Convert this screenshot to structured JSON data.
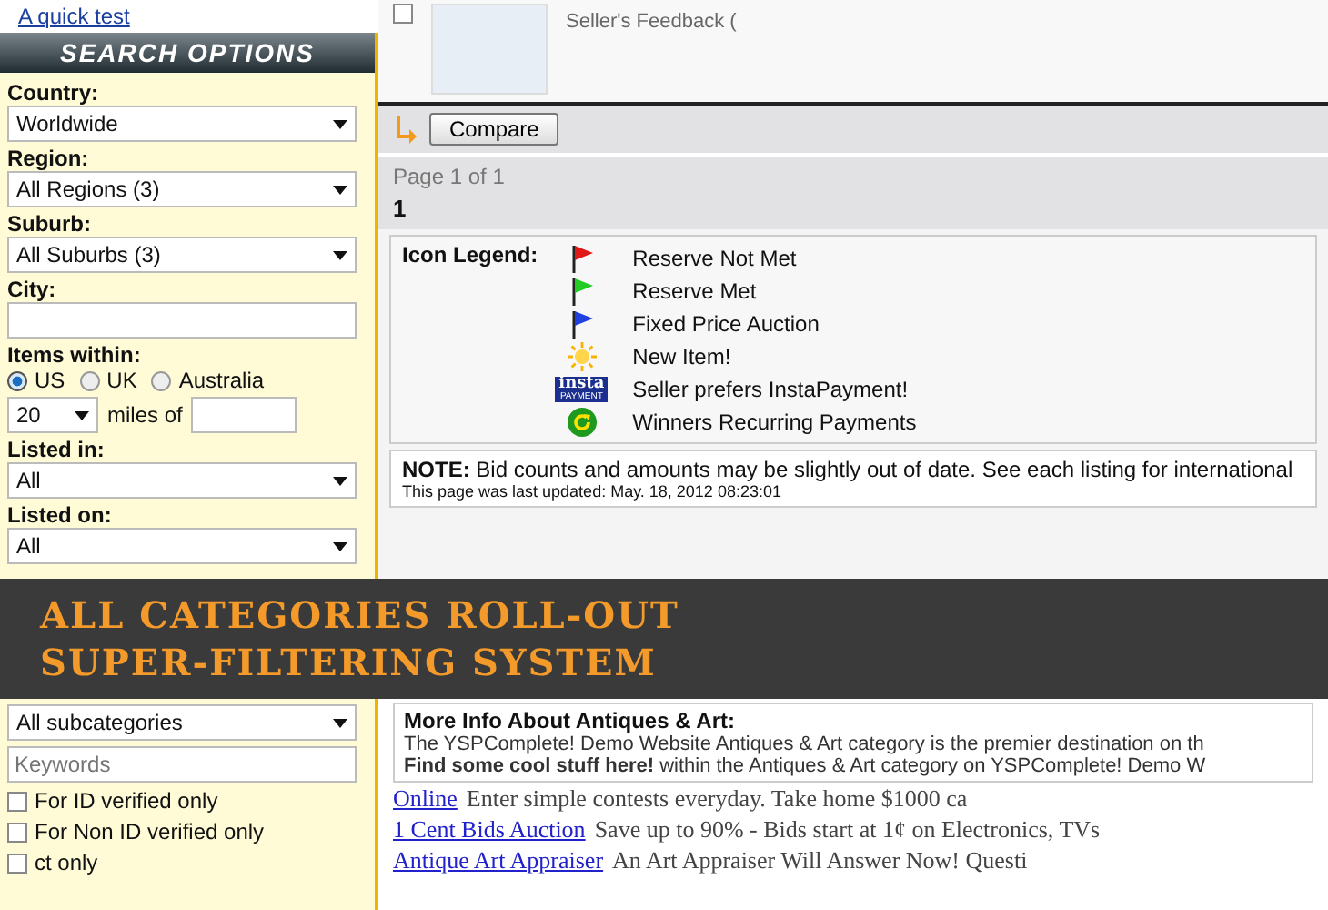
{
  "top_link": "A quick test",
  "sidebar": {
    "title": "SEARCH OPTIONS",
    "fields": [
      {
        "kind": "select",
        "label": "Country:",
        "value": "Worldwide"
      },
      {
        "kind": "select",
        "label": "Region:",
        "value": "All Regions (3)"
      },
      {
        "kind": "select",
        "label": "Suburb:",
        "value": "All Suburbs (3)"
      },
      {
        "kind": "text",
        "label": "City:"
      },
      {
        "kind": "radios",
        "label": "Items within:",
        "options": [
          {
            "label": "US",
            "selected": true
          },
          {
            "label": "UK",
            "selected": false
          },
          {
            "label": "Australia",
            "selected": false
          }
        ]
      },
      {
        "kind": "distance",
        "value": "20",
        "unit": "miles of"
      },
      {
        "kind": "select",
        "label": "Listed in:",
        "value": "All"
      },
      {
        "kind": "select",
        "label": "Listed on:",
        "value": "All"
      }
    ],
    "lower_fields": [
      {
        "kind": "select",
        "value": "All subcategories"
      },
      {
        "kind": "text",
        "placeholder": "Keywords"
      },
      {
        "kind": "checkbox",
        "label": "For ID verified only",
        "checked": false
      },
      {
        "kind": "checkbox",
        "label": "For Non ID verified only",
        "checked": false
      },
      {
        "kind": "checkbox",
        "label": "ct only",
        "checked": false
      }
    ]
  },
  "listing": {
    "checked": false,
    "feedback": "Seller's Feedback ("
  },
  "compare_button": "Compare",
  "pagination": {
    "summary": "Page 1 of 1",
    "pages": [
      {
        "label": "1",
        "selected": true
      }
    ]
  },
  "legend": {
    "title": "Icon Legend:",
    "items": [
      {
        "kind": "flag",
        "color": "#e01818",
        "label": "Reserve Not Met"
      },
      {
        "kind": "flag",
        "color": "#22cc22",
        "label": "Reserve Met"
      },
      {
        "kind": "flag",
        "color": "#2040e0",
        "label": "Fixed Price Auction"
      },
      {
        "kind": "sun",
        "label": "New Item!"
      },
      {
        "kind": "badge",
        "badge_top": "insta",
        "badge_bottom": "PAYMENT",
        "label": "Seller prefers InstaPayment!"
      },
      {
        "kind": "recurring",
        "label": "Winners Recurring Payments"
      }
    ]
  },
  "note": {
    "label": "NOTE:",
    "text": "Bid counts and amounts may be slightly out of date. See each listing for international",
    "updated": "This page was last updated: May. 18, 2012 08:23:01"
  },
  "info": {
    "title": "More Info About Antiques & Art:",
    "lines": [
      "The YSPComplete! Demo Website Antiques & Art category is the premier destination on th",
      "**Find some cool stuff here!** within the Antiques & Art category on YSPComplete! Demo W"
    ]
  },
  "ads": [
    {
      "link": "Online",
      "text": "Enter simple contests everyday. Take home $1000 ca"
    },
    {
      "link": "1 Cent Bids Auction",
      "text": "Save up to 90% - Bids start at 1¢ on Electronics, TVs"
    },
    {
      "link": "Antique Art Appraiser",
      "text": "An Art Appraiser Will Answer Now! Questi"
    }
  ],
  "banner": {
    "lines": [
      "ALL CATEGORIES ROLL-OUT",
      "SUPER-FILTERING SYSTEM"
    ]
  }
}
